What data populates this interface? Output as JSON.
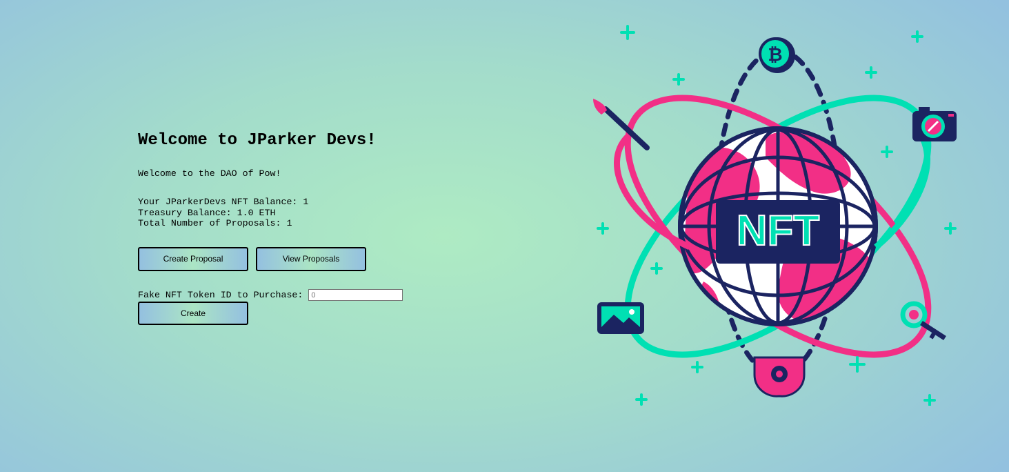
{
  "header": {
    "title": "Welcome to JParker Devs!",
    "subtitle": "Welcome to the DAO of Pow!"
  },
  "stats": {
    "nft_balance": "Your JParkerDevs NFT Balance: 1",
    "treasury_balance": "Treasury Balance: 1.0 ETH",
    "total_proposals": "Total Number of Proposals: 1"
  },
  "actions": {
    "create_proposal_label": "Create Proposal",
    "view_proposals_label": "View Proposals"
  },
  "purchase": {
    "label": "Fake NFT Token ID to Purchase:",
    "input_placeholder": "0",
    "create_label": "Create"
  },
  "illustration": {
    "badge_text": "NFT",
    "icons": [
      "bitcoin-coin-icon",
      "paintbrush-icon",
      "camera-icon",
      "image-icon",
      "key-icon",
      "gear-shield-icon",
      "sparkle-icon"
    ],
    "colors": {
      "pink": "#f22f86",
      "teal": "#00e0b3",
      "navy": "#1b2461",
      "white": "#ffffff"
    }
  }
}
